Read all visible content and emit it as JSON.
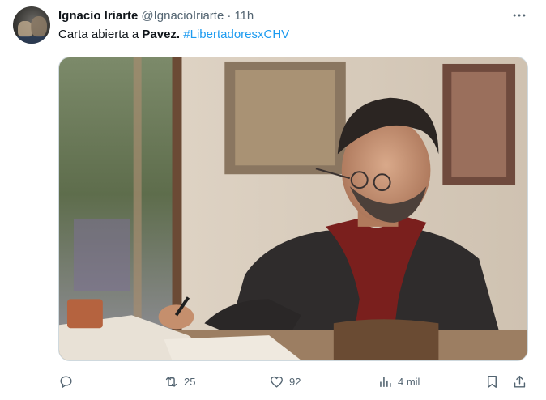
{
  "author": {
    "name": "Ignacio Iriarte",
    "handle": "@IgnacioIriarte",
    "separator": "·",
    "time": "11h"
  },
  "tweet": {
    "text_before": "Carta abierta a ",
    "mention": "Pavez.",
    "hashtag": "#LibertadoresxCHV"
  },
  "media": {
    "alt": "Hombre con bufanda roja escribiendo en un escritorio"
  },
  "actions": {
    "reply_count": "",
    "retweet_count": "25",
    "like_count": "92",
    "views_count": "4 mil"
  },
  "icons": {
    "more": "more-horizontal-icon",
    "reply": "reply-icon",
    "retweet": "retweet-icon",
    "like": "heart-icon",
    "views": "views-chart-icon",
    "bookmark": "bookmark-icon",
    "share": "share-icon"
  },
  "colors": {
    "text": "#0f1419",
    "secondary": "#536471",
    "link": "#1d9bf0",
    "border": "#cfd9de"
  }
}
